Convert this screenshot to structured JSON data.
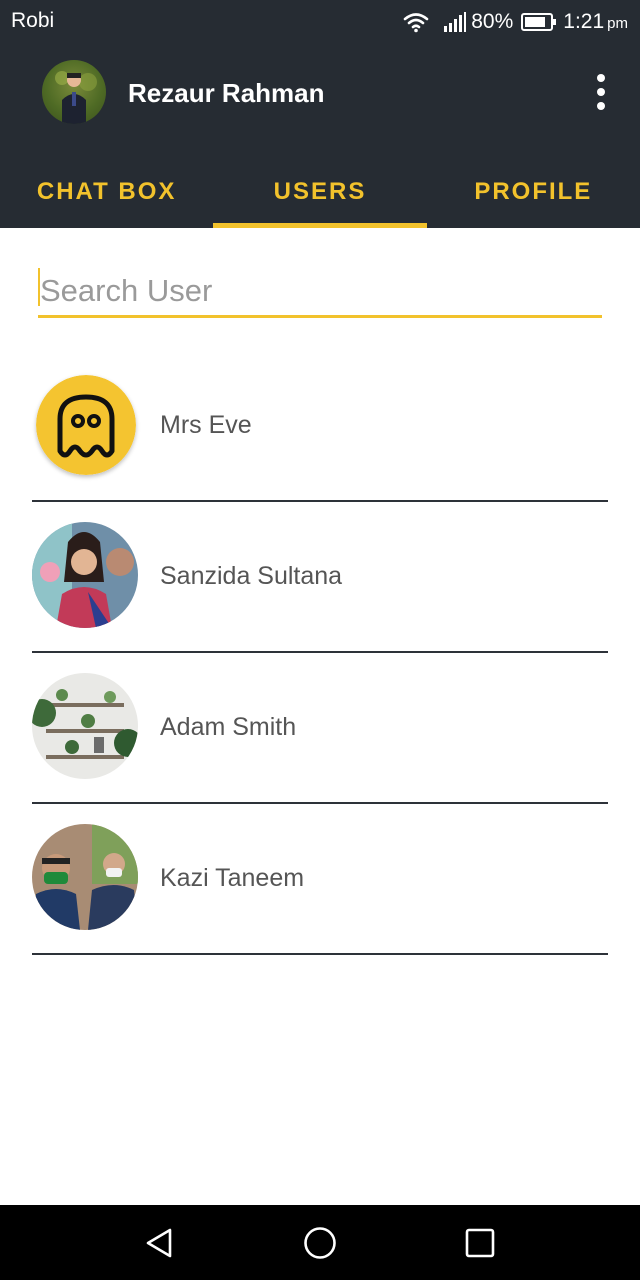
{
  "status_bar": {
    "carrier": "Robi",
    "battery_percent": "80%",
    "time": "1:21",
    "ampm": "pm",
    "icons": [
      "wifi-icon",
      "signal-icon",
      "battery-icon"
    ]
  },
  "app_bar": {
    "user_name": "Rezaur Rahman",
    "menu_icon": "more-vert-icon"
  },
  "tabs": [
    {
      "label": "CHAT BOX",
      "active": false
    },
    {
      "label": "USERS",
      "active": true
    },
    {
      "label": "PROFILE",
      "active": false
    }
  ],
  "search": {
    "placeholder": "Search User",
    "value": ""
  },
  "users": [
    {
      "name": "Mrs Eve",
      "avatar": "ghost-avatar"
    },
    {
      "name": "Sanzida Sultana",
      "avatar": "photo-avatar"
    },
    {
      "name": "Adam Smith",
      "avatar": "photo-avatar"
    },
    {
      "name": "Kazi Taneem",
      "avatar": "photo-avatar"
    }
  ],
  "nav_bar": {
    "buttons": [
      "back-icon",
      "home-icon",
      "recents-icon"
    ]
  },
  "colors": {
    "app_bar": "#262c33",
    "accent": "#f2c22c",
    "divider": "#2d3239",
    "text_secondary": "#555555"
  }
}
